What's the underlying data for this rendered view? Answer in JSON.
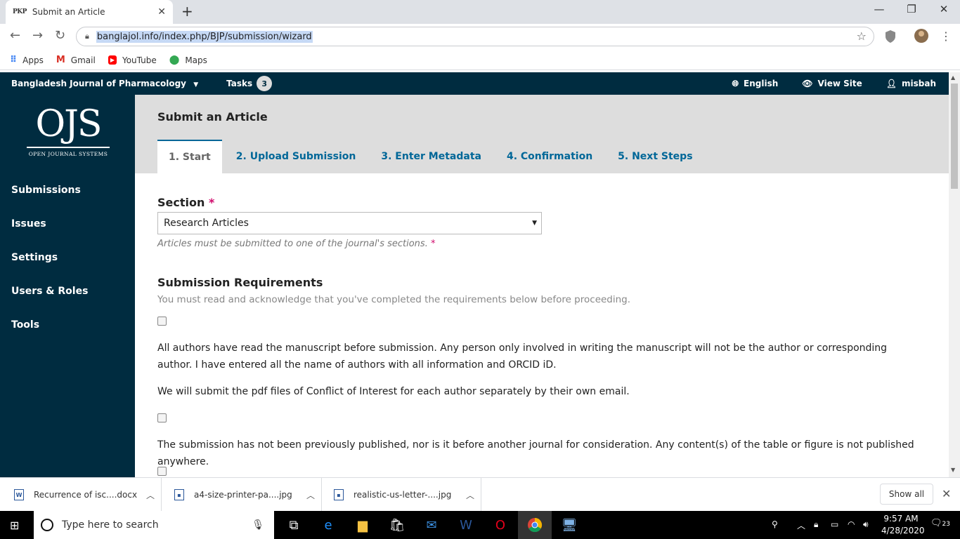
{
  "browser": {
    "tab_title": "Submit an Article",
    "tab_favicon": "PKP",
    "url": "banglajol.info/index.php/BJP/submission/wizard",
    "bookmarks": [
      {
        "label": "Apps",
        "icon": "apps-grid-icon"
      },
      {
        "label": "Gmail",
        "icon": "gmail-icon"
      },
      {
        "label": "YouTube",
        "icon": "youtube-icon"
      },
      {
        "label": "Maps",
        "icon": "maps-icon"
      }
    ]
  },
  "header": {
    "journal": "Bangladesh Journal of Pharmacology",
    "tasks_label": "Tasks",
    "tasks_count": "3",
    "language": "English",
    "view_site": "View Site",
    "user": "misbah"
  },
  "logo": {
    "mark": "OJS",
    "text": "OPEN JOURNAL SYSTEMS"
  },
  "sidebar": {
    "items": [
      "Submissions",
      "Issues",
      "Settings",
      "Users & Roles",
      "Tools"
    ]
  },
  "page": {
    "title": "Submit an Article",
    "tabs": [
      "1. Start",
      "2. Upload Submission",
      "3. Enter Metadata",
      "4. Confirmation",
      "5. Next Steps"
    ]
  },
  "form": {
    "section_label": "Section",
    "required_mark": "*",
    "section_value": "Research Articles",
    "section_hint": "Articles must be submitted to one of the journal's sections.",
    "requirements_title": "Submission Requirements",
    "requirements_desc": "You must read and acknowledge that you've completed the requirements below before proceeding.",
    "requirement_1": "All authors have read the manuscript before submission. Any person only involved in writing the manuscript will not be the author or corresponding author. I have entered all the name of authors with all information and ORCID iD.",
    "requirement_1b": "We will submit the pdf files of Conflict of Interest for each author separately by their own email.",
    "requirement_2": "The submission has not been previously published, nor is it before another journal for consideration. Any content(s) of the table or figure is not published anywhere."
  },
  "downloads": {
    "items": [
      "Recurrence of isc....docx",
      "a4-size-printer-pa....jpg",
      "realistic-us-letter-....jpg"
    ],
    "show_all": "Show all"
  },
  "taskbar": {
    "search_placeholder": "Type here to search",
    "time": "9:57 AM",
    "date": "4/28/2020",
    "notifications": "23"
  },
  "colors": {
    "brand_dark": "#002c40",
    "link": "#006798",
    "required": "#d00a6c"
  }
}
